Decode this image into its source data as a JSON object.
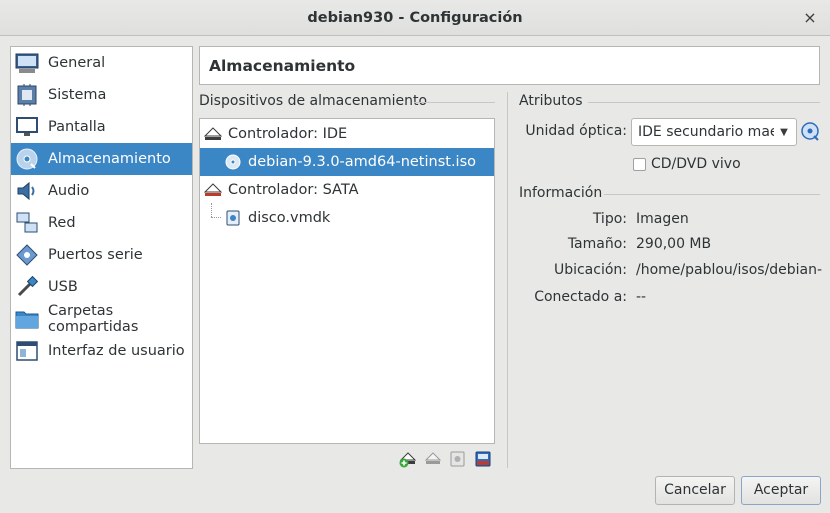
{
  "window": {
    "title": "debian930 - Configuración",
    "close_glyph": "×"
  },
  "sidebar": {
    "items": [
      {
        "label": "General",
        "icon": "monitor-general-icon"
      },
      {
        "label": "Sistema",
        "icon": "chip-icon"
      },
      {
        "label": "Pantalla",
        "icon": "display-icon"
      },
      {
        "label": "Almacenamiento",
        "icon": "storage-disc-icon",
        "selected": true
      },
      {
        "label": "Audio",
        "icon": "speaker-icon"
      },
      {
        "label": "Red",
        "icon": "network-icon"
      },
      {
        "label": "Puertos serie",
        "icon": "serial-port-icon"
      },
      {
        "label": "USB",
        "icon": "usb-icon"
      },
      {
        "label": "Carpetas compartidas",
        "icon": "folder-icon"
      },
      {
        "label": "Interfaz de usuario",
        "icon": "window-ui-icon"
      }
    ]
  },
  "page": {
    "title": "Almacenamiento"
  },
  "storage": {
    "section_label": "Dispositivos de almacenamiento",
    "tree": [
      {
        "label": "Controlador: IDE",
        "icon": "ide-controller-icon",
        "level": 0
      },
      {
        "label": "debian-9.3.0-amd64-netinst.iso",
        "icon": "optical-disc-icon",
        "level": 1,
        "selected": true
      },
      {
        "label": "Controlador: SATA",
        "icon": "sata-controller-icon",
        "level": 0
      },
      {
        "label": "disco.vmdk",
        "icon": "hard-disk-icon",
        "level": 1
      }
    ],
    "toolbar": [
      "add-attachment-icon",
      "remove-attachment-icon",
      "add-controller-icon",
      "remove-controller-icon"
    ]
  },
  "attributes": {
    "section_label": "Atributos",
    "optical_label": "Unidad óptica:",
    "optical_value": "IDE secundario maestro",
    "live_cd_label": "CD/DVD vivo",
    "live_cd_checked": false
  },
  "information": {
    "section_label": "Información",
    "rows": [
      {
        "label": "Tipo:",
        "value": "Imagen"
      },
      {
        "label": "Tamaño:",
        "value": "290,00 MB"
      },
      {
        "label": "Ubicación:",
        "value": "/home/pablou/isos/debian-..."
      },
      {
        "label": "Conectado a:",
        "value": "--"
      }
    ]
  },
  "buttons": {
    "cancel": "Cancelar",
    "accept": "Aceptar"
  },
  "colors": {
    "selection": "#3b86c5",
    "window_bg": "#e8e8e7"
  }
}
